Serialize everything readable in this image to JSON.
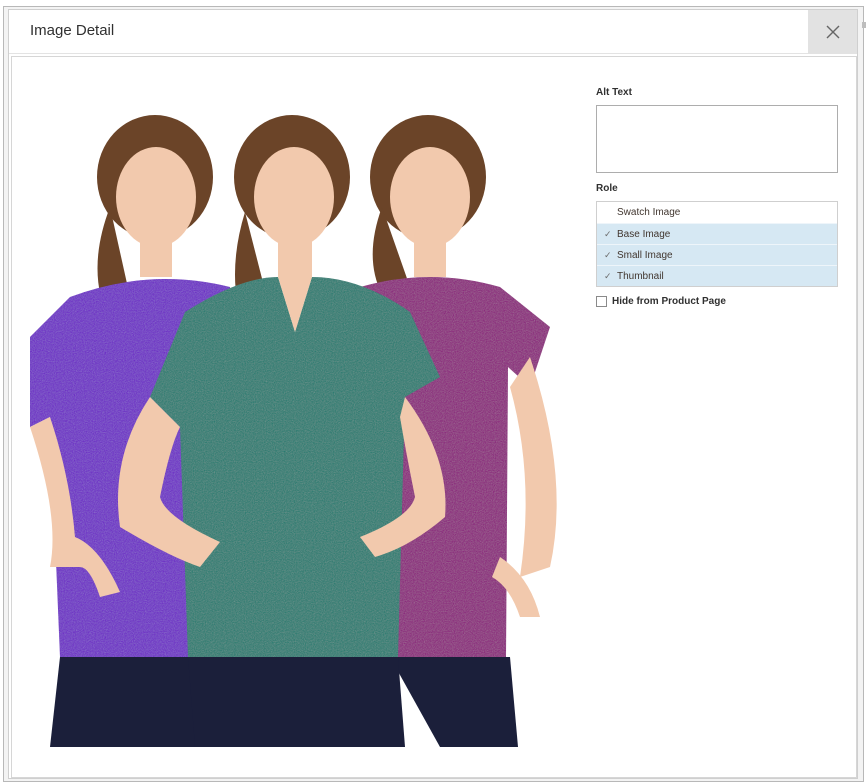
{
  "modal": {
    "title": "Image Detail",
    "close_icon": "close-icon"
  },
  "image": {
    "description_hidden": "",
    "shirt_colors": [
      "#6a1ec8",
      "#127a6e",
      "#8a0f7a"
    ],
    "shorts_color": "#1b1f3a",
    "skin_color": "#f2c9ad",
    "hair_color": "#6b4428"
  },
  "form": {
    "alt_text": {
      "label": "Alt Text",
      "value": ""
    },
    "role": {
      "label": "Role",
      "items": [
        {
          "label": "Swatch Image",
          "selected": false
        },
        {
          "label": "Base Image",
          "selected": true
        },
        {
          "label": "Small Image",
          "selected": true
        },
        {
          "label": "Thumbnail",
          "selected": true
        }
      ],
      "selected_color": "#d6e8f3"
    },
    "hide_from_product_page": {
      "label": "Hide from Product Page",
      "checked": false
    }
  }
}
